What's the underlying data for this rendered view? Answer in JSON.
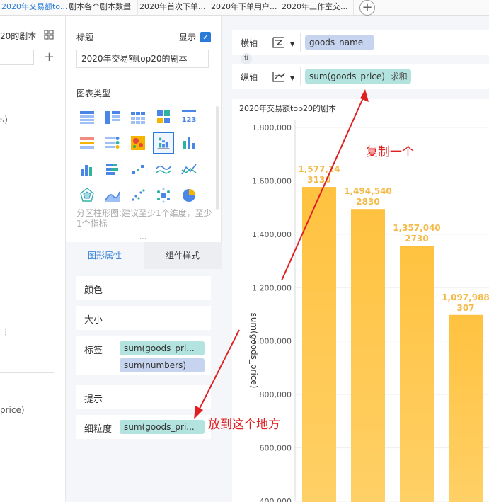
{
  "tabs": [
    {
      "label": "2020年交易额to...",
      "active": true
    },
    {
      "label": "剧本各个剧本数量",
      "active": false
    },
    {
      "label": "2020年首次下单...",
      "active": false
    },
    {
      "label": "2020年下单用户...",
      "active": false
    },
    {
      "label": "2020年工作室交...",
      "active": false
    }
  ],
  "left_panel": {
    "title_fragment": "20的剧本",
    "s_fragment": "s)",
    "price_fragment": "price)"
  },
  "config": {
    "title_label": "标题",
    "show_label": "显示",
    "show_checked": true,
    "title_value": "2020年交易额top20的剧本",
    "chart_type_label": "图表类型",
    "hint": "分区柱形图:建议至少1个维度，至少1个指标",
    "tab_shape": "图形属性",
    "tab_component": "组件样式",
    "props": {
      "color": "颜色",
      "size": "大小",
      "label": "标签",
      "label_fields": [
        "sum(goods_pri...",
        "sum(numbers)"
      ],
      "tooltip": "提示",
      "granularity": "细粒度",
      "granularity_field": "sum(goods_pri..."
    }
  },
  "axes": {
    "x_label": "横轴",
    "x_field": "goods_name",
    "y_label": "纵轴",
    "y_field": "sum(goods_price)",
    "y_agg": "求和"
  },
  "chart_data": {
    "type": "bar",
    "title": "2020年交易额top20的剧本",
    "ylabel": "sum(goods_price)",
    "xlabel": "",
    "ylim": [
      400000,
      1800000
    ],
    "yticks": [
      "1,800,000",
      "1,600,000",
      "1,400,000",
      "1,200,000",
      "1,000,000",
      "800,000",
      "600,000",
      "400,000"
    ],
    "values": [
      1577140,
      1494540,
      1357040,
      1097988
    ],
    "value_labels": [
      "1,577,14",
      "1,494,540",
      "1,357,040",
      "1,097,988"
    ],
    "count_labels": [
      "3130",
      "2830",
      "2730",
      "307"
    ],
    "bar_color": "#ffc653"
  },
  "annotations": {
    "copy": "复制一个",
    "place": "放到这个地方"
  },
  "colors": {
    "accent": "#2a7bd8",
    "arrow": "#e02020",
    "teal_pill": "#b2e3df",
    "blue_pill": "#c6d4ef"
  }
}
